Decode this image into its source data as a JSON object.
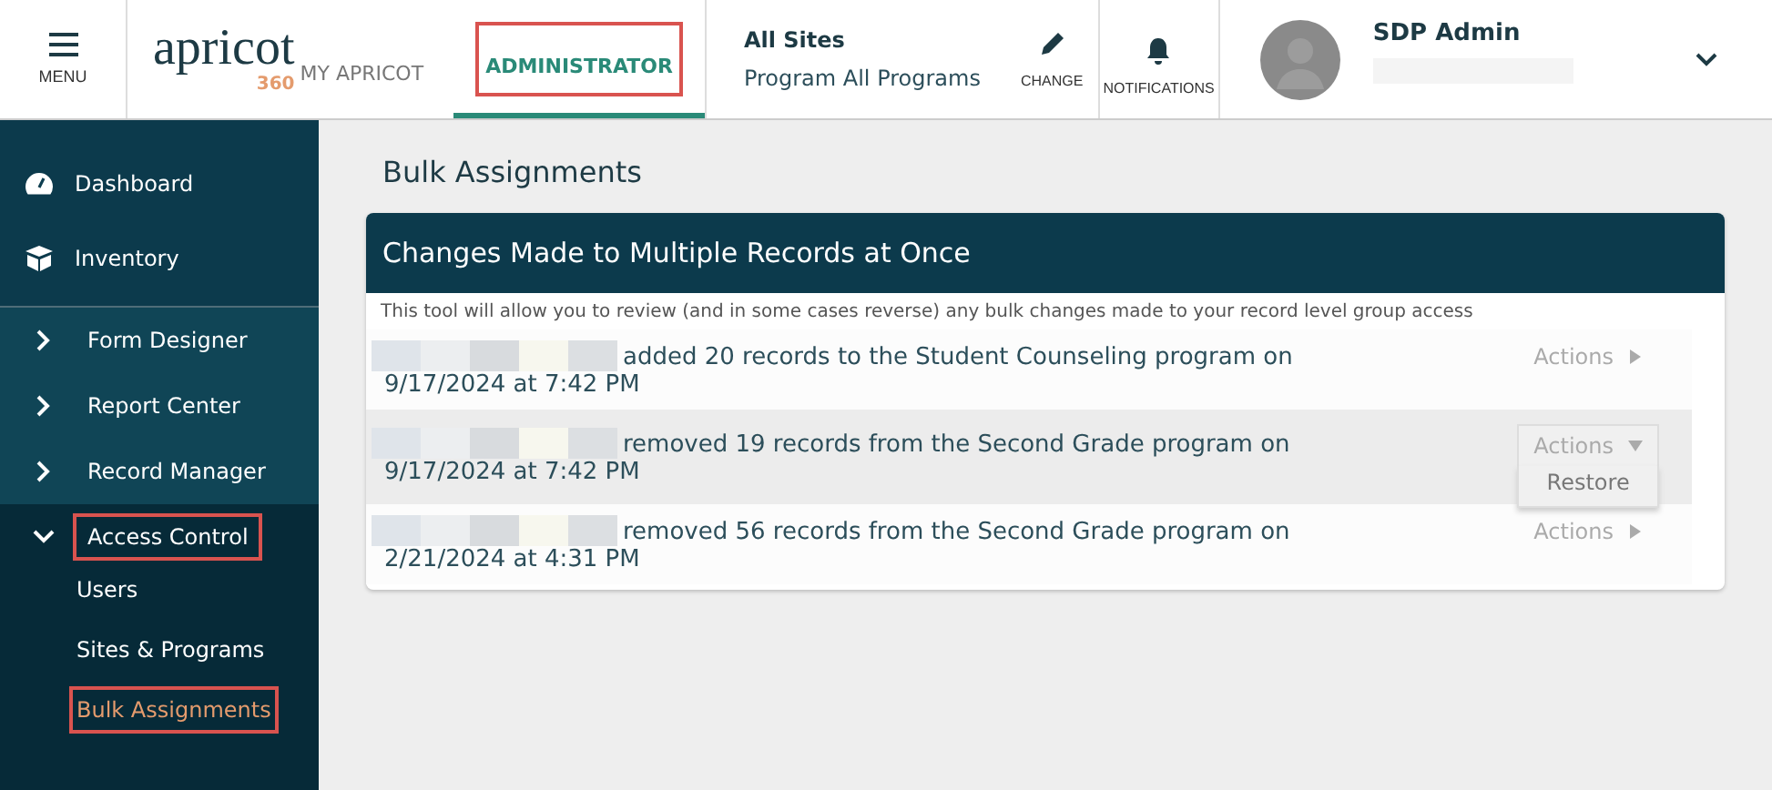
{
  "header": {
    "menu_label": "MENU",
    "logo": {
      "word": "apricot",
      "badge": "360"
    },
    "nav": [
      {
        "label": "MY APRICOT",
        "selected": false,
        "highlighted": false
      },
      {
        "label": "ADMINISTRATOR",
        "selected": true,
        "highlighted": true
      }
    ],
    "site": {
      "title": "All Sites",
      "program": "Program All Programs"
    },
    "change_label": "CHANGE",
    "notifications_label": "NOTIFICATIONS",
    "user": {
      "name": "SDP Admin"
    }
  },
  "sidebar": {
    "top_items": [
      {
        "label": "Dashboard",
        "kind": "dashboard"
      },
      {
        "label": "Inventory",
        "kind": "inventory"
      }
    ],
    "sections": [
      {
        "label": "Form Designer",
        "expanded": false,
        "highlighted": false
      },
      {
        "label": "Report Center",
        "expanded": false,
        "highlighted": false
      },
      {
        "label": "Record Manager",
        "expanded": false,
        "highlighted": false
      },
      {
        "label": "Access Control",
        "expanded": true,
        "highlighted": true,
        "children": [
          {
            "label": "Users",
            "selected": false,
            "highlighted": false
          },
          {
            "label": "Sites & Programs",
            "selected": false,
            "highlighted": false
          },
          {
            "label": "Bulk Assignments",
            "selected": true,
            "highlighted": true
          }
        ]
      }
    ]
  },
  "page_title": "Bulk Assignments",
  "card": {
    "title": "Changes Made to Multiple Records at Once",
    "description": "This tool will allow you to review (and in some cases reverse) any bulk changes made to your record level group access",
    "rows": [
      {
        "summary": "added 20 records to the Student Counseling program on",
        "date": "9/17/2024 at 7:42 PM",
        "actions_label": "Actions",
        "selected": false,
        "menu_open": false
      },
      {
        "summary": "removed 19 records from the Second Grade program on",
        "date": "9/17/2024 at 7:42 PM",
        "actions_label": "Actions",
        "selected": true,
        "menu_open": true,
        "menu_items": [
          "Restore"
        ]
      },
      {
        "summary": "removed 56 records from the Second Grade program on",
        "date": "2/21/2024 at 4:31 PM",
        "actions_label": "Actions",
        "selected": false,
        "menu_open": false
      }
    ]
  }
}
